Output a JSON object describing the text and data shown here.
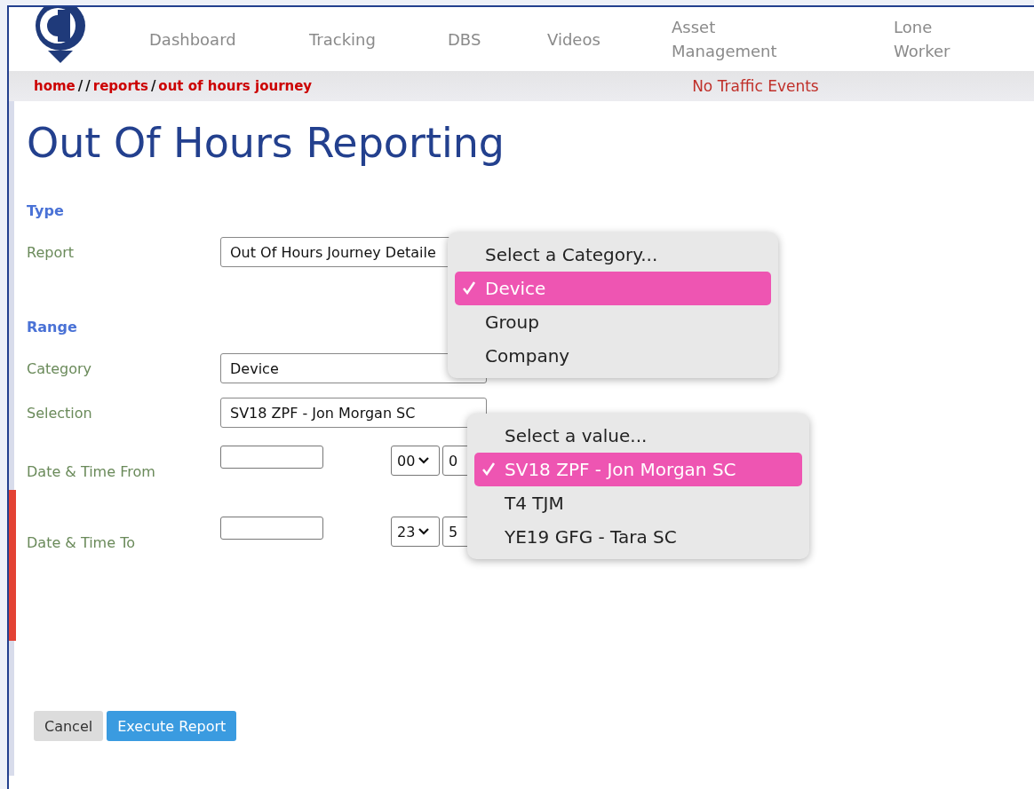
{
  "nav": {
    "items": [
      {
        "label": "Dashboard"
      },
      {
        "label": "Tracking"
      },
      {
        "label": "DBS"
      },
      {
        "label": "Videos"
      },
      {
        "label": "Asset Management"
      },
      {
        "label": "Lone Worker"
      }
    ]
  },
  "breadcrumb": {
    "parts": [
      {
        "kind": "link",
        "text": "home"
      },
      {
        "kind": "separator",
        "text": "/"
      },
      {
        "kind": "separator",
        "text": "/"
      },
      {
        "kind": "link",
        "text": "reports"
      },
      {
        "kind": "separator",
        "text": "/"
      },
      {
        "kind": "link",
        "text": "out of hours journey"
      }
    ]
  },
  "traffic": "No Traffic Events",
  "title": "Out Of Hours Reporting",
  "sections": [
    {
      "heading": "Type",
      "rows": [
        {
          "kind": "select",
          "label": "Report",
          "value": "Out Of Hours Journey Detaile"
        }
      ]
    },
    {
      "heading": "Range",
      "rows": [
        {
          "kind": "select",
          "label": "Category",
          "value": "Device"
        },
        {
          "kind": "select",
          "label": "Selection",
          "value": "SV18 ZPF - Jon Morgan SC"
        },
        {
          "kind": "datetime",
          "label": "Date & Time From",
          "hour": "00",
          "minute": "0"
        },
        {
          "kind": "datetime",
          "label": "Date & Time To",
          "hour": "23",
          "minute": "5"
        }
      ]
    }
  ],
  "category_menu": {
    "options": [
      {
        "label": "Select a Category...",
        "selected": false
      },
      {
        "label": "Device",
        "selected": true
      },
      {
        "label": "Group",
        "selected": false
      },
      {
        "label": "Company",
        "selected": false
      }
    ]
  },
  "value_menu": {
    "options": [
      {
        "label": "Select a value...",
        "selected": false
      },
      {
        "label": "SV18 ZPF - Jon Morgan SC",
        "selected": true
      },
      {
        "label": "T4 TJM",
        "selected": false
      },
      {
        "label": "YE19 GFG - Tara SC",
        "selected": false
      }
    ]
  },
  "buttons": [
    {
      "kind": "secondary",
      "label": "Cancel"
    },
    {
      "kind": "primary",
      "label": "Execute Report"
    }
  ]
}
